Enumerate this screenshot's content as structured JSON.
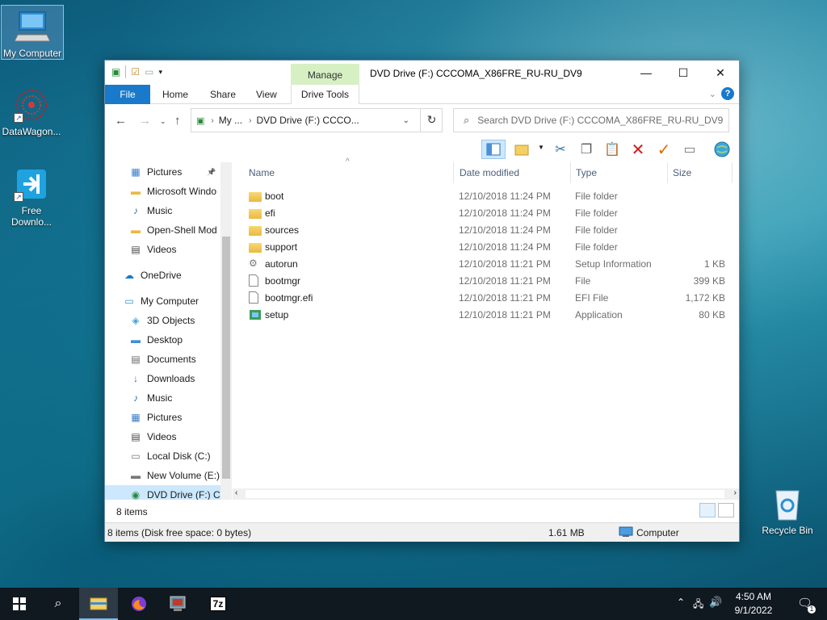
{
  "desktop": {
    "icons": [
      {
        "label": "My Computer"
      },
      {
        "label": "DataWagon..."
      },
      {
        "label": "Free Downlo..."
      },
      {
        "label": "Recycle Bin"
      }
    ]
  },
  "window": {
    "title": "DVD Drive (F:) CCCOMA_X86FRE_RU-RU_DV9",
    "ribbon": {
      "manage_label": "Manage",
      "tabs": [
        "File",
        "Home",
        "Share",
        "View",
        "Drive Tools"
      ]
    },
    "address": {
      "segments": [
        "My ...",
        "DVD Drive (F:) CCCO..."
      ]
    },
    "search": {
      "placeholder": "Search DVD Drive (F:) CCCOMA_X86FRE_RU-RU_DV9"
    },
    "navpane": {
      "items": [
        {
          "label": "Pictures",
          "icon": "pictures-icon",
          "pinned": true
        },
        {
          "label": "Microsoft Windo",
          "icon": "folder-icon"
        },
        {
          "label": "Music",
          "icon": "music-icon"
        },
        {
          "label": "Open-Shell Mod",
          "icon": "folder-icon"
        },
        {
          "label": "Videos",
          "icon": "videos-icon"
        },
        {
          "label": "OneDrive",
          "icon": "onedrive-icon"
        },
        {
          "label": "My Computer",
          "icon": "computer-icon"
        },
        {
          "label": "3D Objects",
          "icon": "3d-objects-icon"
        },
        {
          "label": "Desktop",
          "icon": "desktop-icon"
        },
        {
          "label": "Documents",
          "icon": "documents-icon"
        },
        {
          "label": "Downloads",
          "icon": "downloads-icon"
        },
        {
          "label": "Music",
          "icon": "music-icon"
        },
        {
          "label": "Pictures",
          "icon": "pictures-icon"
        },
        {
          "label": "Videos",
          "icon": "videos-icon"
        },
        {
          "label": "Local Disk (C:)",
          "icon": "local-disk-icon"
        },
        {
          "label": "New Volume (E:)",
          "icon": "drive-icon"
        },
        {
          "label": "DVD Drive (F:) C",
          "icon": "dvd-drive-icon"
        }
      ]
    },
    "columns": [
      "Name",
      "Date modified",
      "Type",
      "Size"
    ],
    "files": [
      {
        "name": "boot",
        "date": "12/10/2018 11:24 PM",
        "type": "File folder",
        "size": "",
        "icon": "folder-icon"
      },
      {
        "name": "efi",
        "date": "12/10/2018 11:24 PM",
        "type": "File folder",
        "size": "",
        "icon": "folder-icon"
      },
      {
        "name": "sources",
        "date": "12/10/2018 11:24 PM",
        "type": "File folder",
        "size": "",
        "icon": "folder-icon"
      },
      {
        "name": "support",
        "date": "12/10/2018 11:24 PM",
        "type": "File folder",
        "size": "",
        "icon": "folder-icon"
      },
      {
        "name": "autorun",
        "date": "12/10/2018 11:21 PM",
        "type": "Setup Information",
        "size": "1 KB",
        "icon": "settings-file-icon"
      },
      {
        "name": "bootmgr",
        "date": "12/10/2018 11:21 PM",
        "type": "File",
        "size": "399 KB",
        "icon": "file-icon"
      },
      {
        "name": "bootmgr.efi",
        "date": "12/10/2018 11:21 PM",
        "type": "EFI File",
        "size": "1,172 KB",
        "icon": "file-icon"
      },
      {
        "name": "setup",
        "date": "12/10/2018 11:21 PM",
        "type": "Application",
        "size": "80 KB",
        "icon": "setup-app-icon"
      }
    ],
    "status": {
      "item_count": "8 items",
      "details": "8 items (Disk free space: 0 bytes)",
      "size": "1.61 MB",
      "location": "Computer"
    }
  },
  "taskbar": {
    "time": "4:50 AM",
    "date": "9/1/2022",
    "notifications_count": "1",
    "sevenzip_label": "7z"
  }
}
